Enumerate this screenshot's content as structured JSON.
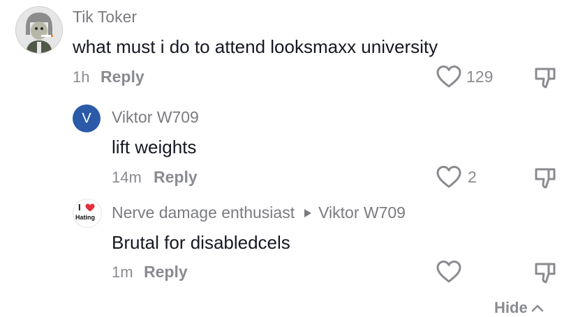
{
  "comments": [
    {
      "username": "Tik Toker",
      "text": "what must i do to attend looksmaxx university",
      "time": "1h",
      "reply_label": "Reply",
      "likes": "129"
    }
  ],
  "replies": [
    {
      "username": "Viktor W709",
      "avatar_letter": "V",
      "text": "lift weights",
      "time": "14m",
      "reply_label": "Reply",
      "likes": "2"
    },
    {
      "username": "Nerve damage enthusiast",
      "reply_to": "Viktor W709",
      "avatar_text_top": "I",
      "avatar_text_bottom": "Hating",
      "text": "Brutal for disabledcels",
      "time": "1m",
      "reply_label": "Reply",
      "likes": ""
    }
  ],
  "hide_label": "Hide",
  "colors": {
    "text_primary": "#161823",
    "text_secondary": "#8a8b91",
    "avatar_blue": "#2b5aa8",
    "heart_red": "#e0313c"
  }
}
